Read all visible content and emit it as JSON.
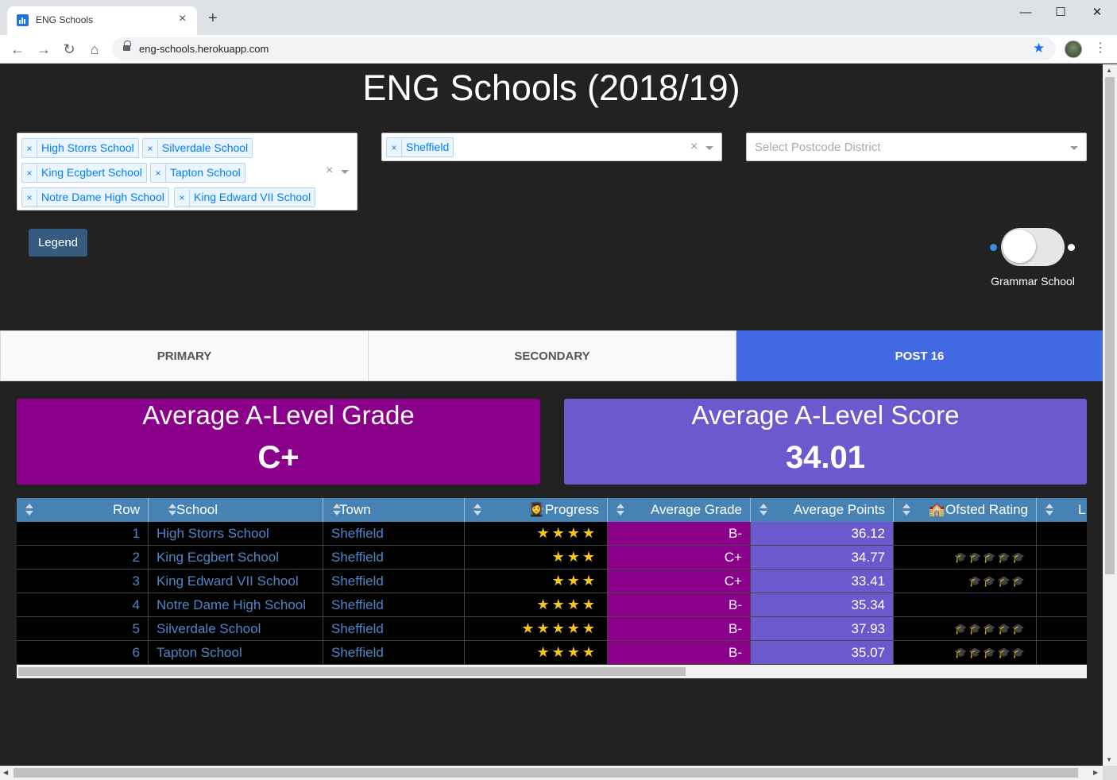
{
  "browser": {
    "tab_title": "ENG Schools",
    "url": "eng-schools.herokuapp.com",
    "icons": {
      "back": "←",
      "forward": "→",
      "reload": "↻",
      "home": "⌂",
      "close_tab": "×",
      "new_tab": "+",
      "bookmark": "★",
      "menu": "⋮",
      "minimize": "—",
      "maximize": "☐",
      "close_window": "✕"
    }
  },
  "page": {
    "title": "ENG Schools (2018/19)"
  },
  "filters": {
    "schools": {
      "clear": "×",
      "chips": [
        "High Storrs School",
        "Silverdale School",
        "King Ecgbert School",
        "Tapton School",
        "Notre Dame High School",
        "King Edward VII School"
      ]
    },
    "town": {
      "clear": "×",
      "chips": [
        "Sheffield"
      ]
    },
    "postcode": {
      "placeholder": "Select Postcode District"
    },
    "chip_remove": "×"
  },
  "legend_button": "Legend",
  "grammar_toggle": {
    "label": "Grammar School",
    "on": false
  },
  "tabs": [
    {
      "label": "PRIMARY",
      "active": false
    },
    {
      "label": "SECONDARY",
      "active": false
    },
    {
      "label": "POST 16",
      "active": true
    }
  ],
  "cards": {
    "grade": {
      "title": "Average A-Level Grade",
      "value": "C+",
      "color": "#8b008b"
    },
    "score": {
      "title": "Average A-Level Score",
      "value": "34.01",
      "color": "#6a5acd"
    }
  },
  "table": {
    "headers": {
      "row": "Row",
      "school": "School",
      "town": "Town",
      "progress": "👩‍🎓Progress",
      "grade": "Average Grade",
      "points": "Average Points",
      "ofsted": "🏫Ofsted Rating",
      "extra": "L"
    },
    "rows": [
      {
        "row": "1",
        "school": "High Storrs School",
        "town": "Sheffield",
        "progress": "★★★★",
        "grade": "B-",
        "points": "36.12",
        "ofsted": ""
      },
      {
        "row": "2",
        "school": "King Ecgbert School",
        "town": "Sheffield",
        "progress": "★★★",
        "grade": "C+",
        "points": "34.77",
        "ofsted": "🎓🎓🎓🎓🎓"
      },
      {
        "row": "3",
        "school": "King Edward VII School",
        "town": "Sheffield",
        "progress": "★★★",
        "grade": "C+",
        "points": "33.41",
        "ofsted": "🎓🎓🎓🎓"
      },
      {
        "row": "4",
        "school": "Notre Dame High School",
        "town": "Sheffield",
        "progress": "★★★★",
        "grade": "B-",
        "points": "35.34",
        "ofsted": ""
      },
      {
        "row": "5",
        "school": "Silverdale School",
        "town": "Sheffield",
        "progress": "★★★★★",
        "grade": "B-",
        "points": "37.93",
        "ofsted": "🎓🎓🎓🎓🎓"
      },
      {
        "row": "6",
        "school": "Tapton School",
        "town": "Sheffield",
        "progress": "★★★★",
        "grade": "B-",
        "points": "35.07",
        "ofsted": "🎓🎓🎓🎓🎓"
      }
    ]
  }
}
